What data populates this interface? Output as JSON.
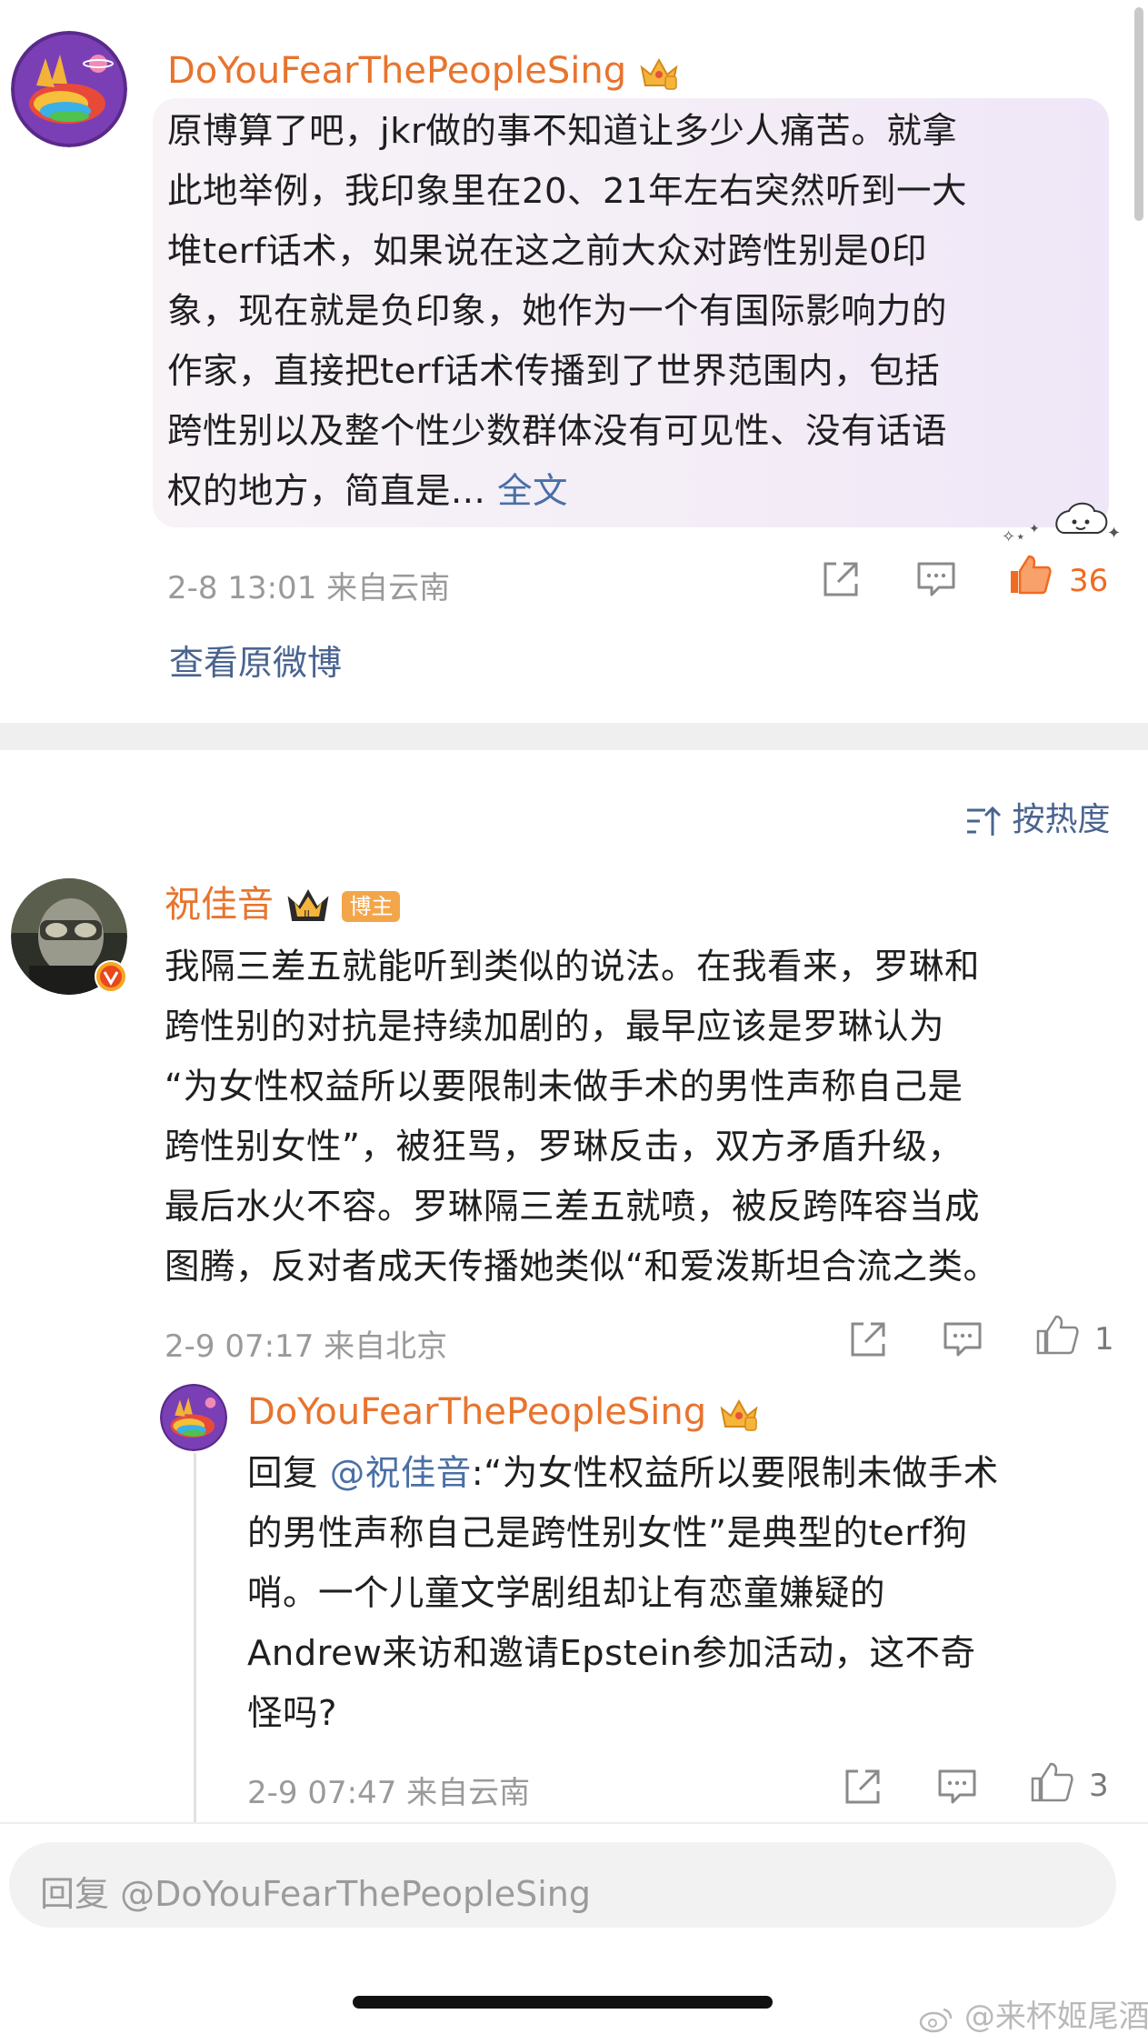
{
  "comments": [
    {
      "username": "DoYouFearThePeopleSing",
      "text_lines": [
        "原博算了吧，jkr做的事不知道让多少人痛苦。就拿",
        "此地举例，我印象里在20、21年左右突然听到一大",
        "堆terf话术，如果说在这之前大众对跨性别是0印",
        "象，现在就是负印象，她作为一个有国际影响力的",
        "作家，直接把terf话术传播到了世界范围内，包括",
        "跨性别以及整个性少数群体没有可见性、没有话语",
        "权的地方，简直是..."
      ],
      "more_link": "全文",
      "time_location": "2-8 13:01 来自云南",
      "likes": "36",
      "view_original": "查看原微博"
    },
    {
      "username": "祝佳音",
      "badge": "博主",
      "text_lines": [
        "我隔三差五就能听到类似的说法。在我看来，罗琳和",
        "跨性别的对抗是持续加剧的，最早应该是罗琳认为",
        "“为女性权益所以要限制未做手术的男性声称自己是",
        "跨性别女性”，被狂骂，罗琳反击，双方矛盾升级，",
        "最后水火不容。罗琳隔三差五就喷，被反跨阵容当成",
        "图腾，反对者成天传播她类似“和爱泼斯坦合流之类。"
      ],
      "time_location": "2-9 07:17 来自北京",
      "likes": "1"
    },
    {
      "username": "DoYouFearThePeopleSing",
      "reply_prefix": "回复",
      "mention": "@祝佳音",
      "text_lines": [
        ":“为女性权益所以要限制未做手术",
        "的男性声称自己是跨性别女性”是典型的terf狗",
        "哨。一个儿童文学剧组却让有恋童嫌疑的",
        "Andrew来访和邀请Epstein参加活动，这不奇",
        "怪吗?"
      ],
      "time_location": "2-9 07:47 来自云南",
      "likes": "3"
    }
  ],
  "sort_label": "按热度",
  "reply_placeholder": "回复 @DoYouFearThePeopleSing",
  "watermark": "@来杯姬尾酒",
  "icons": [
    "share-icon",
    "comment-icon",
    "like-icon",
    "sort-icon",
    "crown-icon",
    "weibo-logo-icon"
  ],
  "colors": {
    "username": "#e8742e",
    "link": "#4a6fa5",
    "like_active": "#f06a20"
  }
}
